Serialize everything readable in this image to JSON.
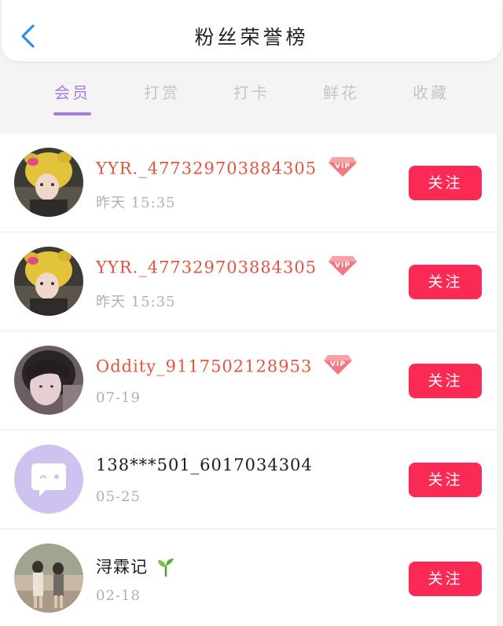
{
  "header": {
    "title": "粉丝荣誉榜",
    "back_icon": "back-chevron-icon"
  },
  "colors": {
    "accent": "#a57de0",
    "follow_button": "#fa2a55",
    "vip_name": "#e0563f",
    "time": "#b0b0b0"
  },
  "tabs": [
    {
      "label": "会员",
      "active": true
    },
    {
      "label": "打赏",
      "active": false
    },
    {
      "label": "打卡",
      "active": false
    },
    {
      "label": "鲜花",
      "active": false
    },
    {
      "label": "收藏",
      "active": false
    }
  ],
  "fans": [
    {
      "name": "YYR._477329703884305",
      "vip": true,
      "time": "昨天 15:35",
      "follow_label": "关注",
      "avatar": "girl-yellow-hood-photo"
    },
    {
      "name": "YYR._477329703884305",
      "vip": true,
      "time": "昨天 15:35",
      "follow_label": "关注",
      "avatar": "girl-yellow-hood-photo"
    },
    {
      "name": "Oddity_9117502128953",
      "vip": true,
      "time": "07-19",
      "follow_label": "关注",
      "avatar": "girl-portrait-photo"
    },
    {
      "name": "138***501_6017034304",
      "vip": false,
      "time": "05-25",
      "follow_label": "关注",
      "avatar": "default-chat-bubble-avatar"
    },
    {
      "name": "浔霖记",
      "vip": false,
      "emoji": "🌱",
      "time": "02-18",
      "follow_label": "关注",
      "avatar": "two-girls-street-photo"
    }
  ],
  "vip_badge_text": "VIP"
}
